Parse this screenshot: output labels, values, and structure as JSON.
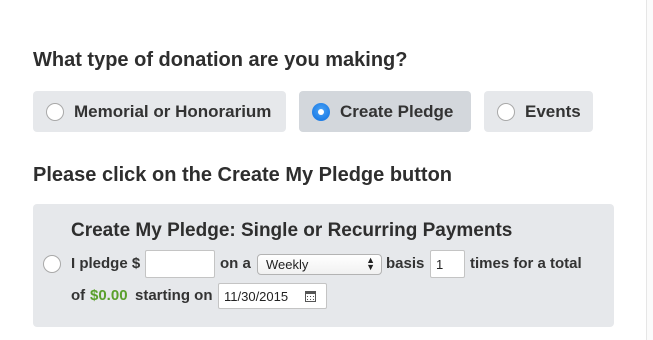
{
  "donation_type": {
    "heading": "What type of donation are you making?",
    "options": [
      {
        "label": "Memorial or Honorarium",
        "selected": false
      },
      {
        "label": "Create Pledge",
        "selected": true
      },
      {
        "label": "Events",
        "selected": false
      }
    ]
  },
  "pledge_section": {
    "heading": "Please click on the Create My Pledge button",
    "title": "Create My Pledge: Single or Recurring Payments",
    "selected": false,
    "i_pledge_label": "I pledge $",
    "amount_value": "",
    "on_a_label": "on a",
    "frequency_value": "Weekly",
    "basis_label": "basis",
    "times_value": "1",
    "times_label": "times for a total",
    "of_label": "of",
    "total_amount": "$0.00",
    "starting_label": "starting on",
    "start_date": "11/30/2015"
  },
  "colors": {
    "panel_bg": "#e6e8eb",
    "selected_option_bg": "#d3d7dc",
    "radio_checked": "#1f7ee6",
    "total_amount": "#5aa02c"
  },
  "icons": {
    "frequency_select": "select-caret-icon",
    "date_picker": "calendar-icon"
  }
}
